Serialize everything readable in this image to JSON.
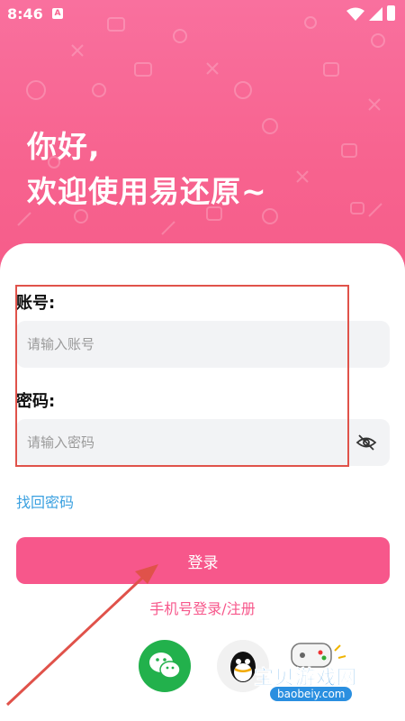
{
  "status": {
    "time": "8:46",
    "app_glyph": "A"
  },
  "hero": {
    "line1": "你好,",
    "line2": "欢迎使用易还原~"
  },
  "form": {
    "account_label": "账号:",
    "account_placeholder": "请输入账号",
    "password_label": "密码:",
    "password_placeholder": "请输入密码"
  },
  "links": {
    "forgot": "找回密码",
    "phone_login": "手机号登录/注册"
  },
  "login_button": "登录",
  "watermark": {
    "name": "宝贝游戏网",
    "url": "baobeiy.com"
  },
  "colors": {
    "brand": "#f7578b",
    "link": "#3aa0e0",
    "wechat": "#22b14c",
    "highlight": "#e0524a"
  },
  "icons": [
    "wifi-icon",
    "signal-icon",
    "battery-icon",
    "eye-hidden-icon",
    "wechat-icon",
    "qq-icon"
  ]
}
